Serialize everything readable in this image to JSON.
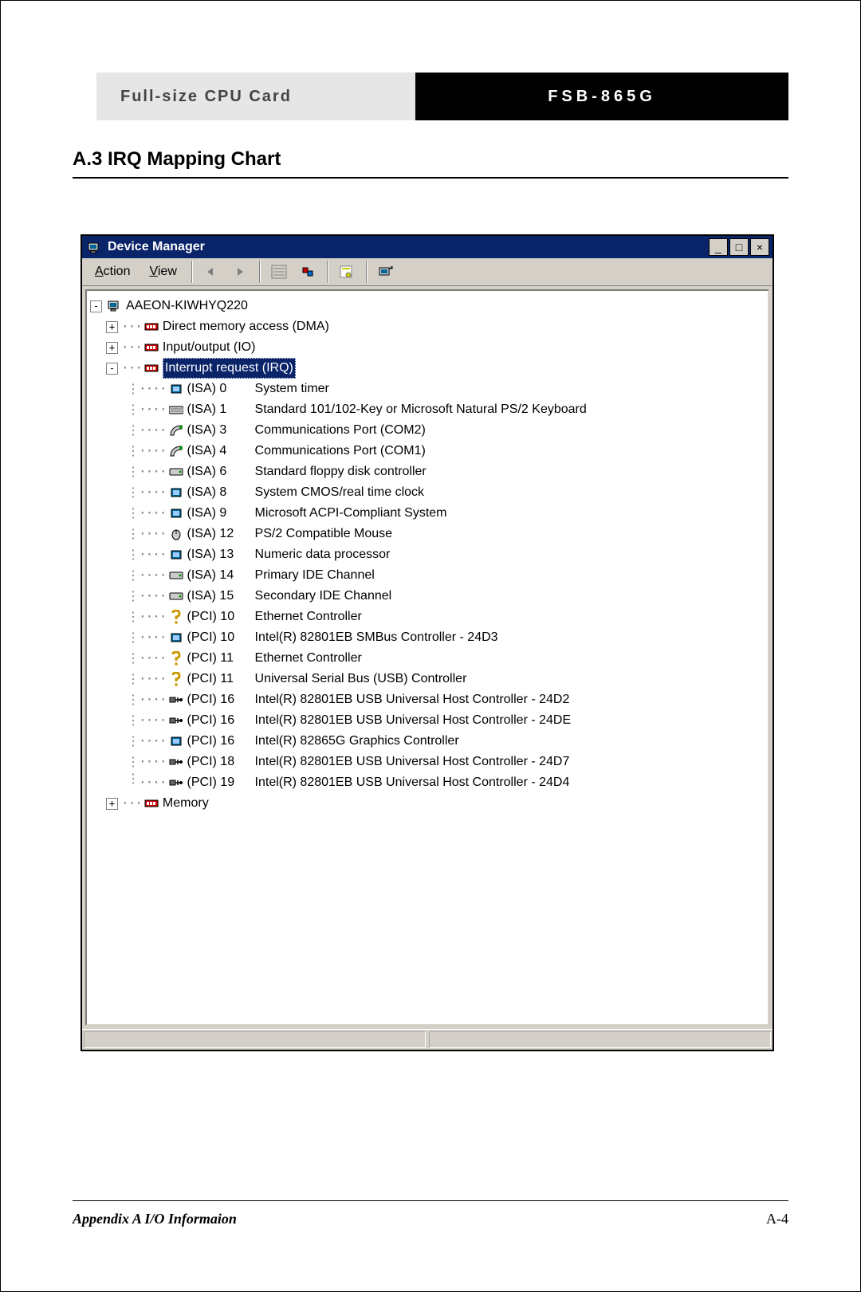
{
  "doc_header": {
    "left": "Full-size CPU Card",
    "right": "FSB-865G"
  },
  "section_title": "A.3 IRQ Mapping Chart",
  "window": {
    "title": "Device Manager",
    "menu": {
      "action": "Action",
      "view": "View"
    },
    "tree": {
      "root": "AAEON-KIWHYQ220",
      "branches": {
        "dma": "Direct memory access (DMA)",
        "io": "Input/output (IO)",
        "irq": "Interrupt request (IRQ)",
        "memory": "Memory"
      },
      "irq_items": [
        {
          "icon": "chip",
          "bus": "(ISA) 0",
          "name": "System timer"
        },
        {
          "icon": "kbd",
          "bus": "(ISA) 1",
          "name": "Standard 101/102-Key or Microsoft Natural PS/2 Keyboard"
        },
        {
          "icon": "port",
          "bus": "(ISA) 3",
          "name": "Communications Port (COM2)"
        },
        {
          "icon": "port",
          "bus": "(ISA) 4",
          "name": "Communications Port (COM1)"
        },
        {
          "icon": "disk",
          "bus": "(ISA) 6",
          "name": "Standard floppy disk controller"
        },
        {
          "icon": "chip",
          "bus": "(ISA) 8",
          "name": "System CMOS/real time clock"
        },
        {
          "icon": "chip",
          "bus": "(ISA) 9",
          "name": "Microsoft ACPI-Compliant System"
        },
        {
          "icon": "mouse",
          "bus": "(ISA) 12",
          "name": "PS/2 Compatible Mouse"
        },
        {
          "icon": "chip",
          "bus": "(ISA) 13",
          "name": "Numeric data processor"
        },
        {
          "icon": "disk",
          "bus": "(ISA) 14",
          "name": "Primary IDE Channel"
        },
        {
          "icon": "disk",
          "bus": "(ISA) 15",
          "name": "Secondary IDE Channel"
        },
        {
          "icon": "unknown",
          "bus": "(PCI) 10",
          "name": "Ethernet Controller"
        },
        {
          "icon": "chip",
          "bus": "(PCI) 10",
          "name": "Intel(R) 82801EB SMBus Controller - 24D3"
        },
        {
          "icon": "unknown",
          "bus": "(PCI) 11",
          "name": "Ethernet Controller"
        },
        {
          "icon": "unknown",
          "bus": "(PCI) 11",
          "name": "Universal Serial Bus (USB) Controller"
        },
        {
          "icon": "usb",
          "bus": "(PCI) 16",
          "name": "Intel(R) 82801EB USB Universal Host Controller - 24D2"
        },
        {
          "icon": "usb",
          "bus": "(PCI) 16",
          "name": "Intel(R) 82801EB USB Universal Host Controller - 24DE"
        },
        {
          "icon": "chip",
          "bus": "(PCI) 16",
          "name": "Intel(R) 82865G Graphics Controller"
        },
        {
          "icon": "usb",
          "bus": "(PCI) 18",
          "name": "Intel(R) 82801EB USB Universal Host Controller - 24D7"
        },
        {
          "icon": "usb",
          "bus": "(PCI) 19",
          "name": "Intel(R) 82801EB USB Universal Host Controller - 24D4"
        }
      ]
    }
  },
  "footer": {
    "left": "Appendix A I/O Informaion",
    "right": "A-4"
  }
}
